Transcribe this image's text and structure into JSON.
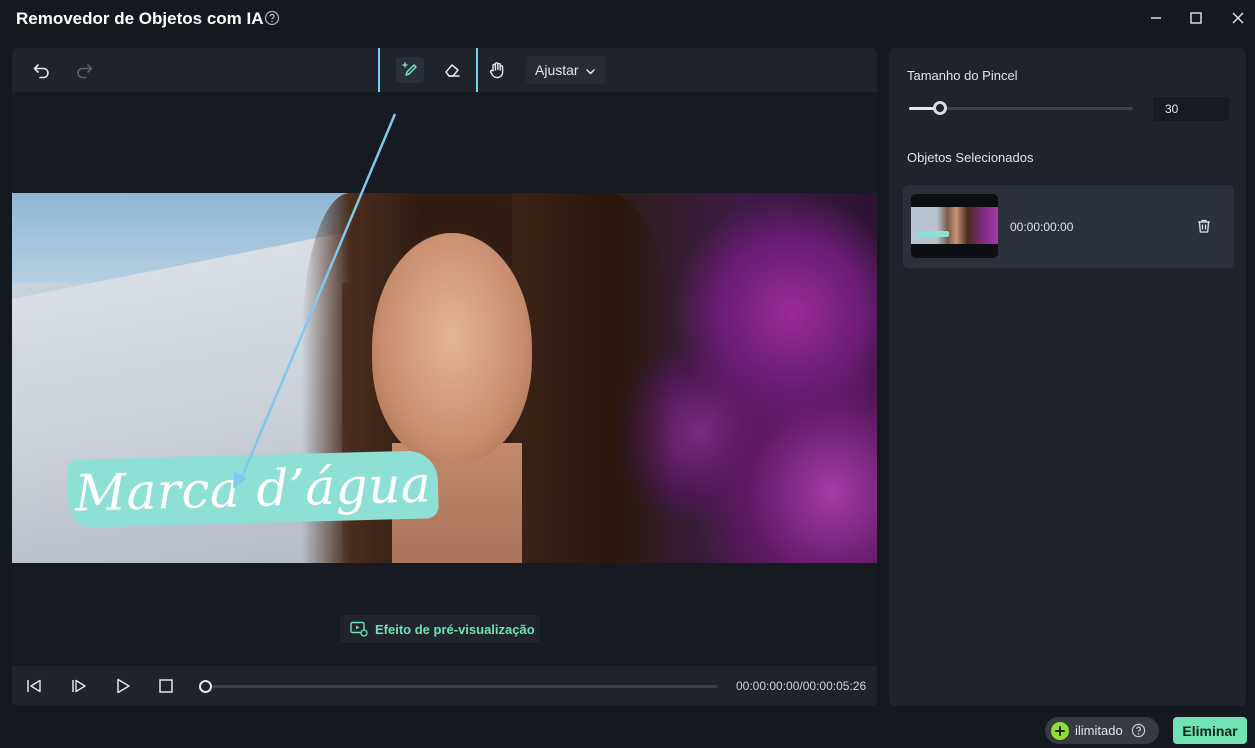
{
  "window": {
    "title": "Removedor de Objetos com IA"
  },
  "toolbar": {
    "adjust_label": "Ajustar"
  },
  "canvas": {
    "watermark_text": "Marca d’água",
    "preview_effect_label": "Efeito de pré-visualização"
  },
  "playback": {
    "timecode": "00:00:00:00/00:00:05:26",
    "progress": 0
  },
  "side": {
    "brush_size_label": "Tamanho do Pincel",
    "brush_size_value": "30",
    "brush_size_fraction": 0.14,
    "selected_objects_label": "Objetos Selecionados",
    "objects": [
      {
        "time": "00:00:00:00"
      }
    ]
  },
  "footer": {
    "unlimited_label": "ilimitado",
    "remove_label": "Eliminar"
  },
  "colors": {
    "accent": "#6fe3b3",
    "highlight_box": "#6fd3ee",
    "watermark_bg": "#8fe0d4",
    "plus_badge": "#8fdc3c"
  }
}
